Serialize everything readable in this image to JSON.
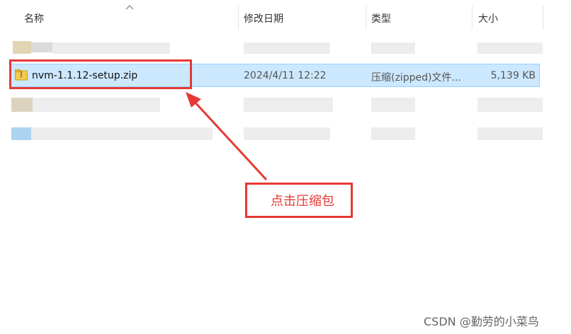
{
  "columns": {
    "name": "名称",
    "modified": "修改日期",
    "type": "类型",
    "size": "大小"
  },
  "selected_file": {
    "name": "nvm-1.1.12-setup.zip",
    "modified": "2024/4/11 12:22",
    "type": "压缩(zipped)文件...",
    "size": "5,139 KB",
    "icon": "zip-folder-icon"
  },
  "annotation": {
    "callout": "点击压缩包",
    "color": "#e53935"
  },
  "watermark": "CSDN @勤劳的小菜鸟",
  "colors": {
    "selection_fill": "#cce8ff",
    "selection_border": "#99d1ff"
  }
}
